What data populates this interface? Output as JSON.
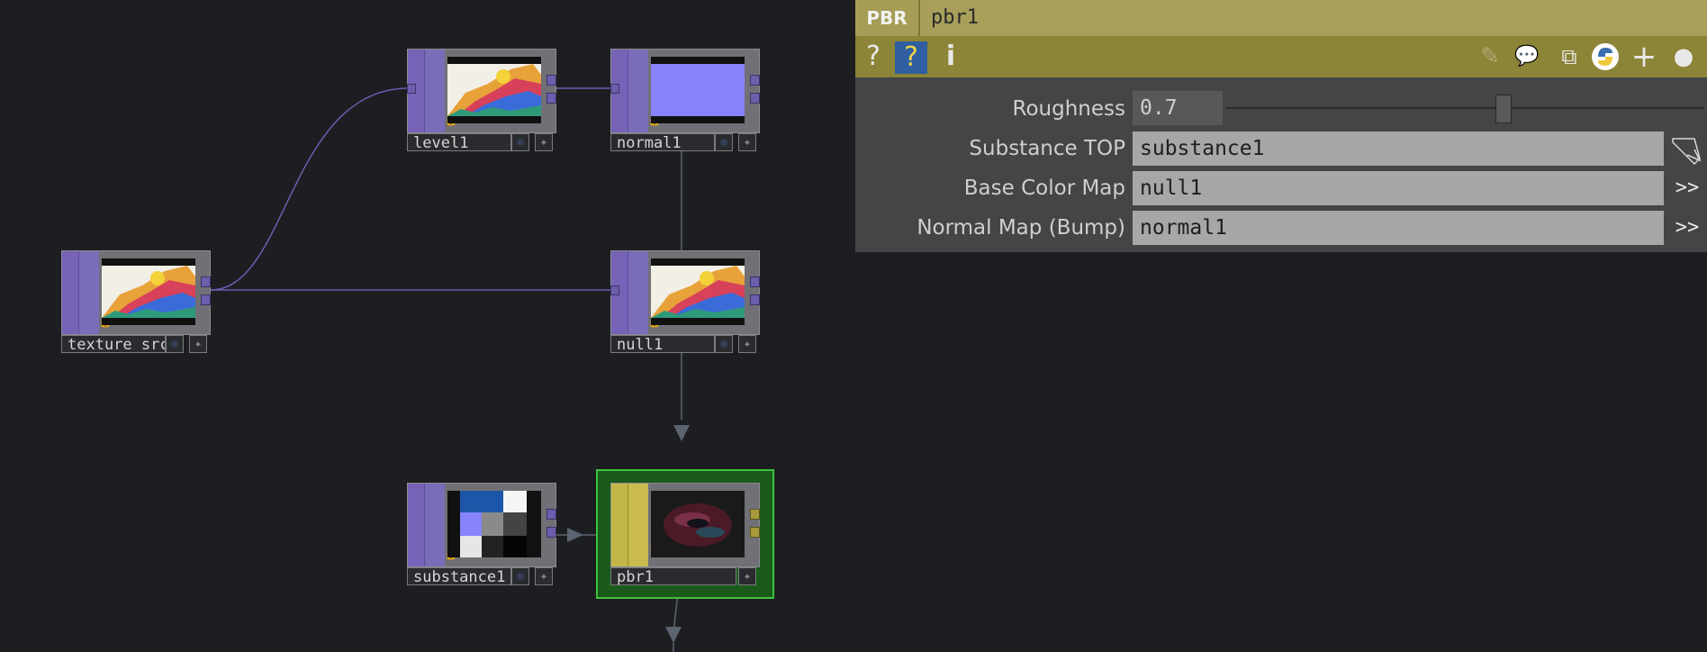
{
  "network": {
    "nodes": [
      {
        "id": "texture_src",
        "label": "texture_src",
        "preview": "colorful-splash"
      },
      {
        "id": "level1",
        "label": "level1",
        "preview": "colorful-splash"
      },
      {
        "id": "normal1",
        "label": "normal1",
        "preview": "solid-lavender"
      },
      {
        "id": "null1",
        "label": "null1",
        "preview": "colorful-splash"
      },
      {
        "id": "substance1",
        "label": "substance1",
        "preview": "material-swatch"
      },
      {
        "id": "pbr1",
        "label": "pbr1",
        "preview": "dark-torus"
      }
    ],
    "colors": {
      "top_node": "#7662b6",
      "mat_node": "#c4b74a",
      "selection": "#3fc23f",
      "wire": "#6b5db0",
      "wire_gray": "#5c6470"
    }
  },
  "panel": {
    "op_type": "PBR",
    "op_name": "pbr1",
    "toolbar": {
      "help_icon": "?",
      "python_help_icon": "?",
      "info_icon": "i",
      "right_icons": [
        "pencil-icon",
        "comment-icon",
        "clone-icon",
        "python-icon",
        "plus-icon",
        "circle-icon"
      ]
    },
    "params": [
      {
        "label": "Roughness",
        "value": "0.7",
        "slider_fraction": 0.58
      },
      {
        "label": "Substance TOP",
        "value": "substance1"
      },
      {
        "label": "Base Color Map",
        "value": "null1",
        "button": ">>"
      },
      {
        "label": "Normal Map (Bump)",
        "value": "normal1",
        "button": ">>"
      }
    ]
  }
}
